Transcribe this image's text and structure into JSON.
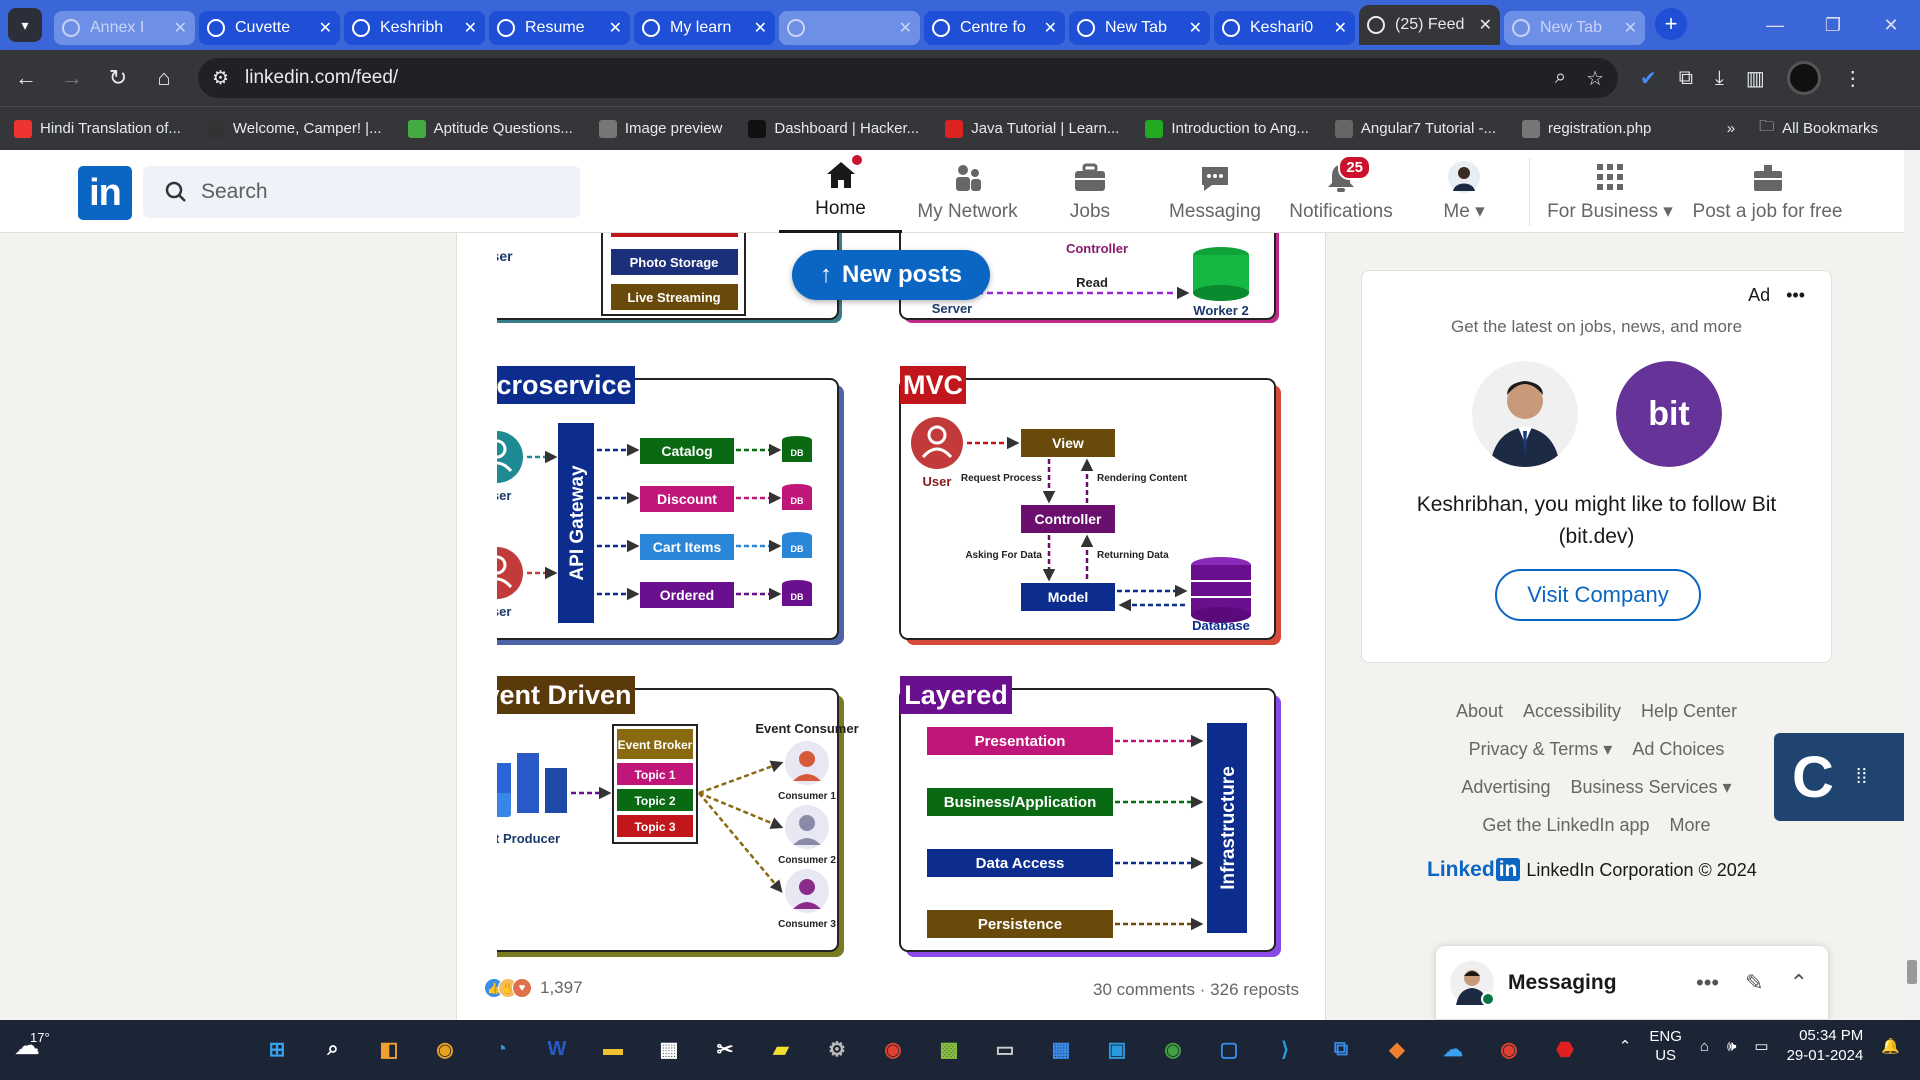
{
  "browser": {
    "tabs": [
      {
        "title": "Annex I",
        "style": "dim",
        "icon": "gmail-icon"
      },
      {
        "title": "Cuvette",
        "style": "normal",
        "icon": "cuvette-icon"
      },
      {
        "title": "Keshribh",
        "style": "normal",
        "icon": "cuvette-icon"
      },
      {
        "title": "Resume",
        "style": "normal",
        "icon": "globe-icon"
      },
      {
        "title": "My learn",
        "style": "normal",
        "icon": "app-icon"
      },
      {
        "title": "",
        "style": "dim",
        "icon": "app-icon"
      },
      {
        "title": "Centre fo",
        "style": "normal",
        "icon": "google-icon"
      },
      {
        "title": "New Tab",
        "style": "normal",
        "icon": "chrome-icon"
      },
      {
        "title": "Keshari0",
        "style": "normal",
        "icon": "github-icon"
      },
      {
        "title": "(25) Feed",
        "style": "active",
        "icon": "linkedin-icon"
      },
      {
        "title": "New Tab",
        "style": "dim",
        "icon": "chrome-icon"
      }
    ],
    "url": "linkedin.com/feed/",
    "bookmarks": [
      {
        "label": "Hindi Translation of...",
        "color": "#e33"
      },
      {
        "label": "Welcome, Camper! |...",
        "color": "#333"
      },
      {
        "label": "Aptitude Questions...",
        "color": "#4a4"
      },
      {
        "label": "Image preview",
        "color": "#777"
      },
      {
        "label": "Dashboard | Hacker...",
        "color": "#111"
      },
      {
        "label": "Java Tutorial | Learn...",
        "color": "#d22"
      },
      {
        "label": "Introduction to Ang...",
        "color": "#2a2"
      },
      {
        "label": "Angular7 Tutorial -...",
        "color": "#666"
      },
      {
        "label": "registration.php",
        "color": "#777"
      }
    ],
    "all_bookmarks": "All Bookmarks"
  },
  "linkedin": {
    "search_placeholder": "Search",
    "nav": {
      "home": "Home",
      "network": "My Network",
      "jobs": "Jobs",
      "messaging": "Messaging",
      "notifications": "Notifications",
      "notif_count": "25",
      "me": "Me",
      "business": "For Business",
      "post_job": "Post a job for free"
    },
    "new_posts": "New posts",
    "reaction_count": "1,397",
    "comments": "30 comments",
    "reposts": "326 reposts",
    "ad": {
      "label": "Ad",
      "tagline": "Get the latest on jobs, news, and more",
      "bit_logo": "bit",
      "message": "Keshribhan, you might like to follow Bit (bit.dev)",
      "button": "Visit Company"
    },
    "footer_rows": [
      [
        "About",
        "Accessibility",
        "Help Center"
      ],
      [
        "Privacy & Terms ▾",
        "Ad Choices"
      ],
      [
        "Advertising",
        "Business Services ▾"
      ],
      [
        "Get the LinkedIn app",
        "More"
      ]
    ],
    "copyright_logo": "Linked",
    "copyright": "LinkedIn Corporation © 2024",
    "messaging": "Messaging"
  },
  "diagram": {
    "top_user": "User",
    "photo_storage": "Photo Storage",
    "live_streaming": "Live Streaming",
    "controller_top": "Controller",
    "read": "Read",
    "server": "Server",
    "worker2": "Worker 2",
    "microservice": {
      "title": "Microservice",
      "gateway": "API Gateway",
      "user": "User",
      "services": [
        "Catalog",
        "Discount",
        "Cart Items",
        "Ordered"
      ],
      "db": "DB"
    },
    "mvc": {
      "title": "MVC",
      "user": "User",
      "view": "View",
      "controller": "Controller",
      "model": "Model",
      "database": "Database",
      "request": "Request Process",
      "rendering": "Rendering Content",
      "asking": "Asking For Data",
      "returning": "Returning Data"
    },
    "event": {
      "title": "Event Driven",
      "producer": "Event Producer",
      "broker": "Event Broker",
      "topics": [
        "Topic 1",
        "Topic 2",
        "Topic 3"
      ],
      "consumer_title": "Event Consumer",
      "consumers": [
        "Consumer 1",
        "Consumer 2",
        "Consumer 3"
      ]
    },
    "layered": {
      "title": "Layered",
      "layers": [
        "Presentation",
        "Business/Application",
        "Data Access",
        "Persistence"
      ],
      "infra": "Infrastructure"
    }
  },
  "taskbar": {
    "temp": "17°",
    "lang1": "ENG",
    "lang2": "US",
    "time": "05:34 PM",
    "date": "29-01-2024"
  }
}
